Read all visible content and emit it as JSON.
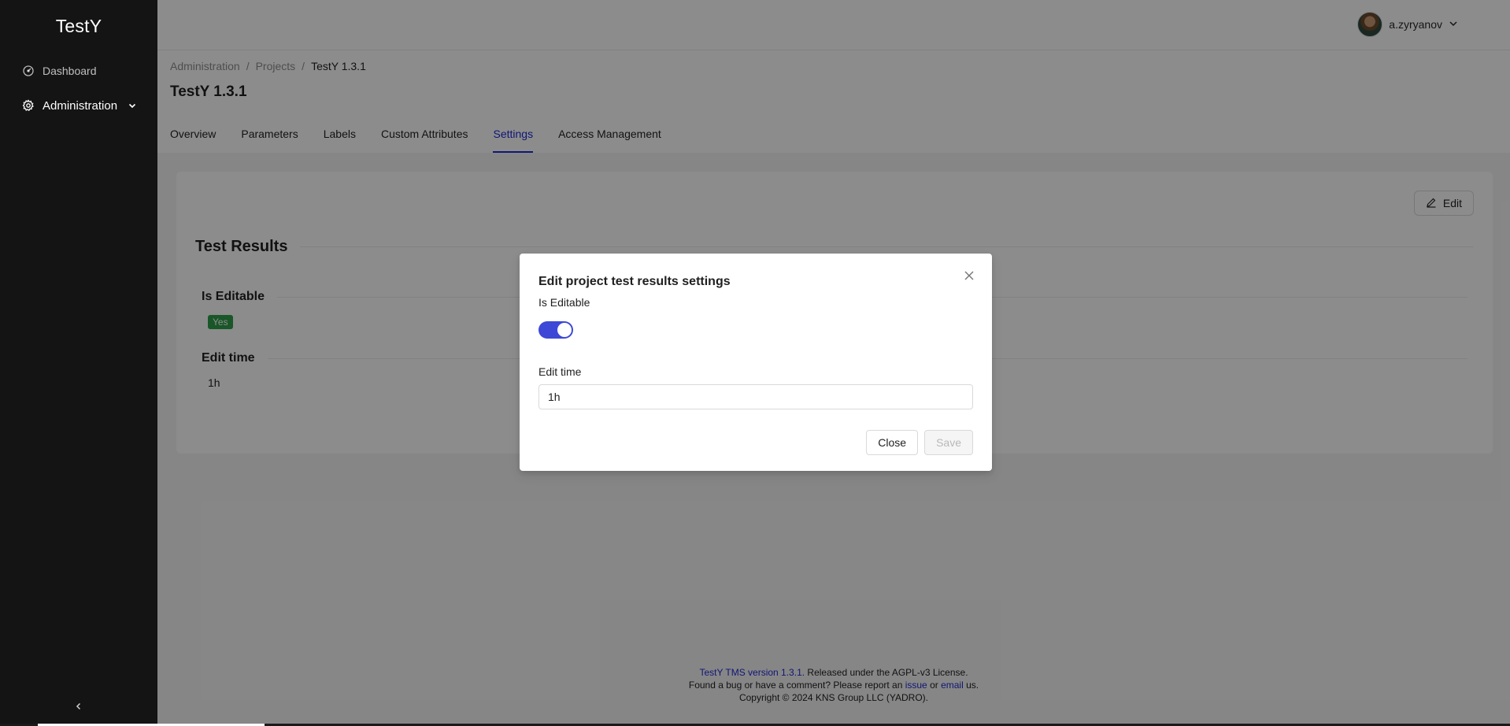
{
  "app": {
    "title": "TestY"
  },
  "sidebar": {
    "items": [
      {
        "label": "Dashboard",
        "icon": "dashboard-icon"
      },
      {
        "label": "Administration",
        "icon": "gear-icon"
      }
    ]
  },
  "header": {
    "user_name": "a.zyryanov"
  },
  "breadcrumb": [
    "Administration",
    "Projects",
    "TestY 1.3.1"
  ],
  "page_title": "TestY 1.3.1",
  "tabs": [
    {
      "label": "Overview"
    },
    {
      "label": "Parameters"
    },
    {
      "label": "Labels"
    },
    {
      "label": "Custom Attributes"
    },
    {
      "label": "Settings"
    },
    {
      "label": "Access Management"
    }
  ],
  "active_tab": "Settings",
  "settings": {
    "edit_label": "Edit",
    "section_title": "Test Results",
    "is_editable_label": "Is Editable",
    "is_editable_value": "Yes",
    "edit_time_label": "Edit time",
    "edit_time_value": "1h"
  },
  "modal": {
    "title": "Edit project test results settings",
    "is_editable_label": "Is Editable",
    "is_editable_on": true,
    "edit_time_label": "Edit time",
    "edit_time_value": "1h",
    "close_label": "Close",
    "save_label": "Save"
  },
  "footer": {
    "version_link": "TestY TMS version 1.3.1.",
    "license_text": " Released under the AGPL-v3 License.",
    "bug_text": "Found a bug or have a comment?  Please report an ",
    "issue_link": "issue",
    "or_text": " or ",
    "email_link": "email",
    "us_text": " us.",
    "copyright": "Copyright © 2024 KNS Group LLC (YADRO)."
  },
  "colors": {
    "accent": "#1f2bd6",
    "switch_on": "#3e48d6",
    "tag_yes": "#2e9d4a",
    "sidebar_bg": "#141414"
  }
}
